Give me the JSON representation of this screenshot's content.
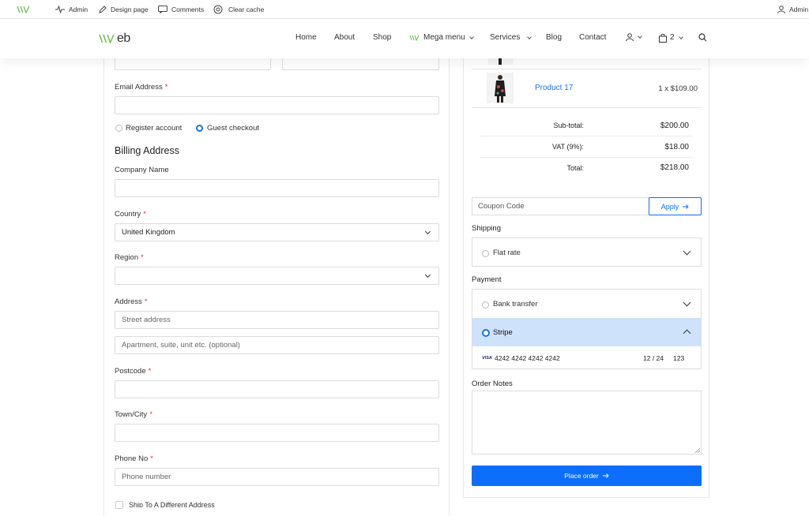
{
  "admin_bar": {
    "items": [
      "Admin",
      "Design page",
      "Comments",
      "Clear cache"
    ],
    "user": "Admin"
  },
  "nav": {
    "logo_text": "eb",
    "links": [
      "Home",
      "About",
      "Shop",
      "Mega menu",
      "Services",
      "Blog",
      "Contact"
    ],
    "cart_count": "2"
  },
  "form": {
    "email_label": "Email Address",
    "register_label": "Register account",
    "guest_label": "Guest checkout",
    "billing_heading": "Billing Address",
    "company_label": "Company Name",
    "country_label": "Country",
    "country_value": "United Kingdom",
    "region_label": "Region",
    "address_label": "Address",
    "street_placeholder": "Street address",
    "apartment_placeholder": "Apartment, suite, unit etc. (optional)",
    "postcode_label": "Postcode",
    "town_label": "Town/City",
    "phone_label": "Phone No",
    "phone_placeholder": "Phone number",
    "ship_different_label": "Ship To A Different Address",
    "required_mark": "*"
  },
  "order": {
    "product_name": "Product 17",
    "product_qty_price": "1 x $109.00",
    "subtotal_label": "Sub-total:",
    "subtotal_value": "$200.00",
    "vat_label": "VAT (9%):",
    "vat_value": "$18.00",
    "total_label": "Total:",
    "total_value": "$218.00",
    "coupon_placeholder": "Coupon Code",
    "apply_label": "Apply",
    "shipping_heading": "Shipping",
    "shipping_method": "Flat rate",
    "payment_heading": "Payment",
    "payment_bank": "Bank transfer",
    "payment_stripe": "Stripe",
    "card_brand": "VISA",
    "card_number": "4242 4242 4242 4242",
    "card_expiry": "12 / 24",
    "card_cvc": "123",
    "notes_heading": "Order Notes",
    "place_order_label": "Place order"
  },
  "colors": {
    "accent": "#0d6efd",
    "logo_green": "#6cc04a",
    "stripe_bg": "#cfe2fb",
    "link": "#1a73e8"
  }
}
